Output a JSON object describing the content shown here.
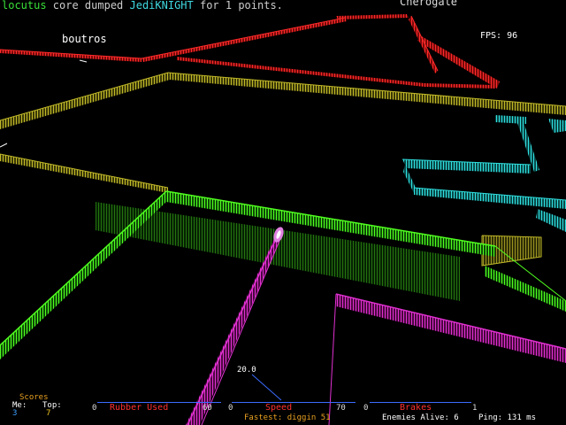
{
  "killfeed": {
    "killer": "locutus",
    "verb": " core dumped ",
    "victim": "JediKNIGHT",
    "suffix": " for 1 points."
  },
  "players": {
    "distant_name": "Cherogale",
    "near_name": "boutros"
  },
  "fps": "FPS: 96",
  "scores": {
    "title": "Scores",
    "me_label": "Me:",
    "top_label": "Top:",
    "me_value": "3",
    "top_value": "7"
  },
  "gauges": {
    "rubber": {
      "label": "Rubber Used",
      "min": "0",
      "max": "60",
      "used_fraction": 0.0
    },
    "speed": {
      "label": "Speed",
      "min": "0",
      "max": "70",
      "readout": "20.0"
    },
    "brakes": {
      "label": "Brakes",
      "min": "0",
      "max": "1"
    }
  },
  "status": {
    "fastest": "Fastest: diggin 51",
    "enemies": "Enemies Alive: 6",
    "ping": "Ping: 131 ms"
  },
  "colors": {
    "wall_red": "#ff2a2a",
    "wall_yellow": "#b8b020",
    "wall_cyan": "#22c8c8",
    "wall_green": "#40f020",
    "wall_magenta": "#d020c0",
    "cycle": "#e080e0",
    "gauge_bar": "#3a6cff"
  }
}
